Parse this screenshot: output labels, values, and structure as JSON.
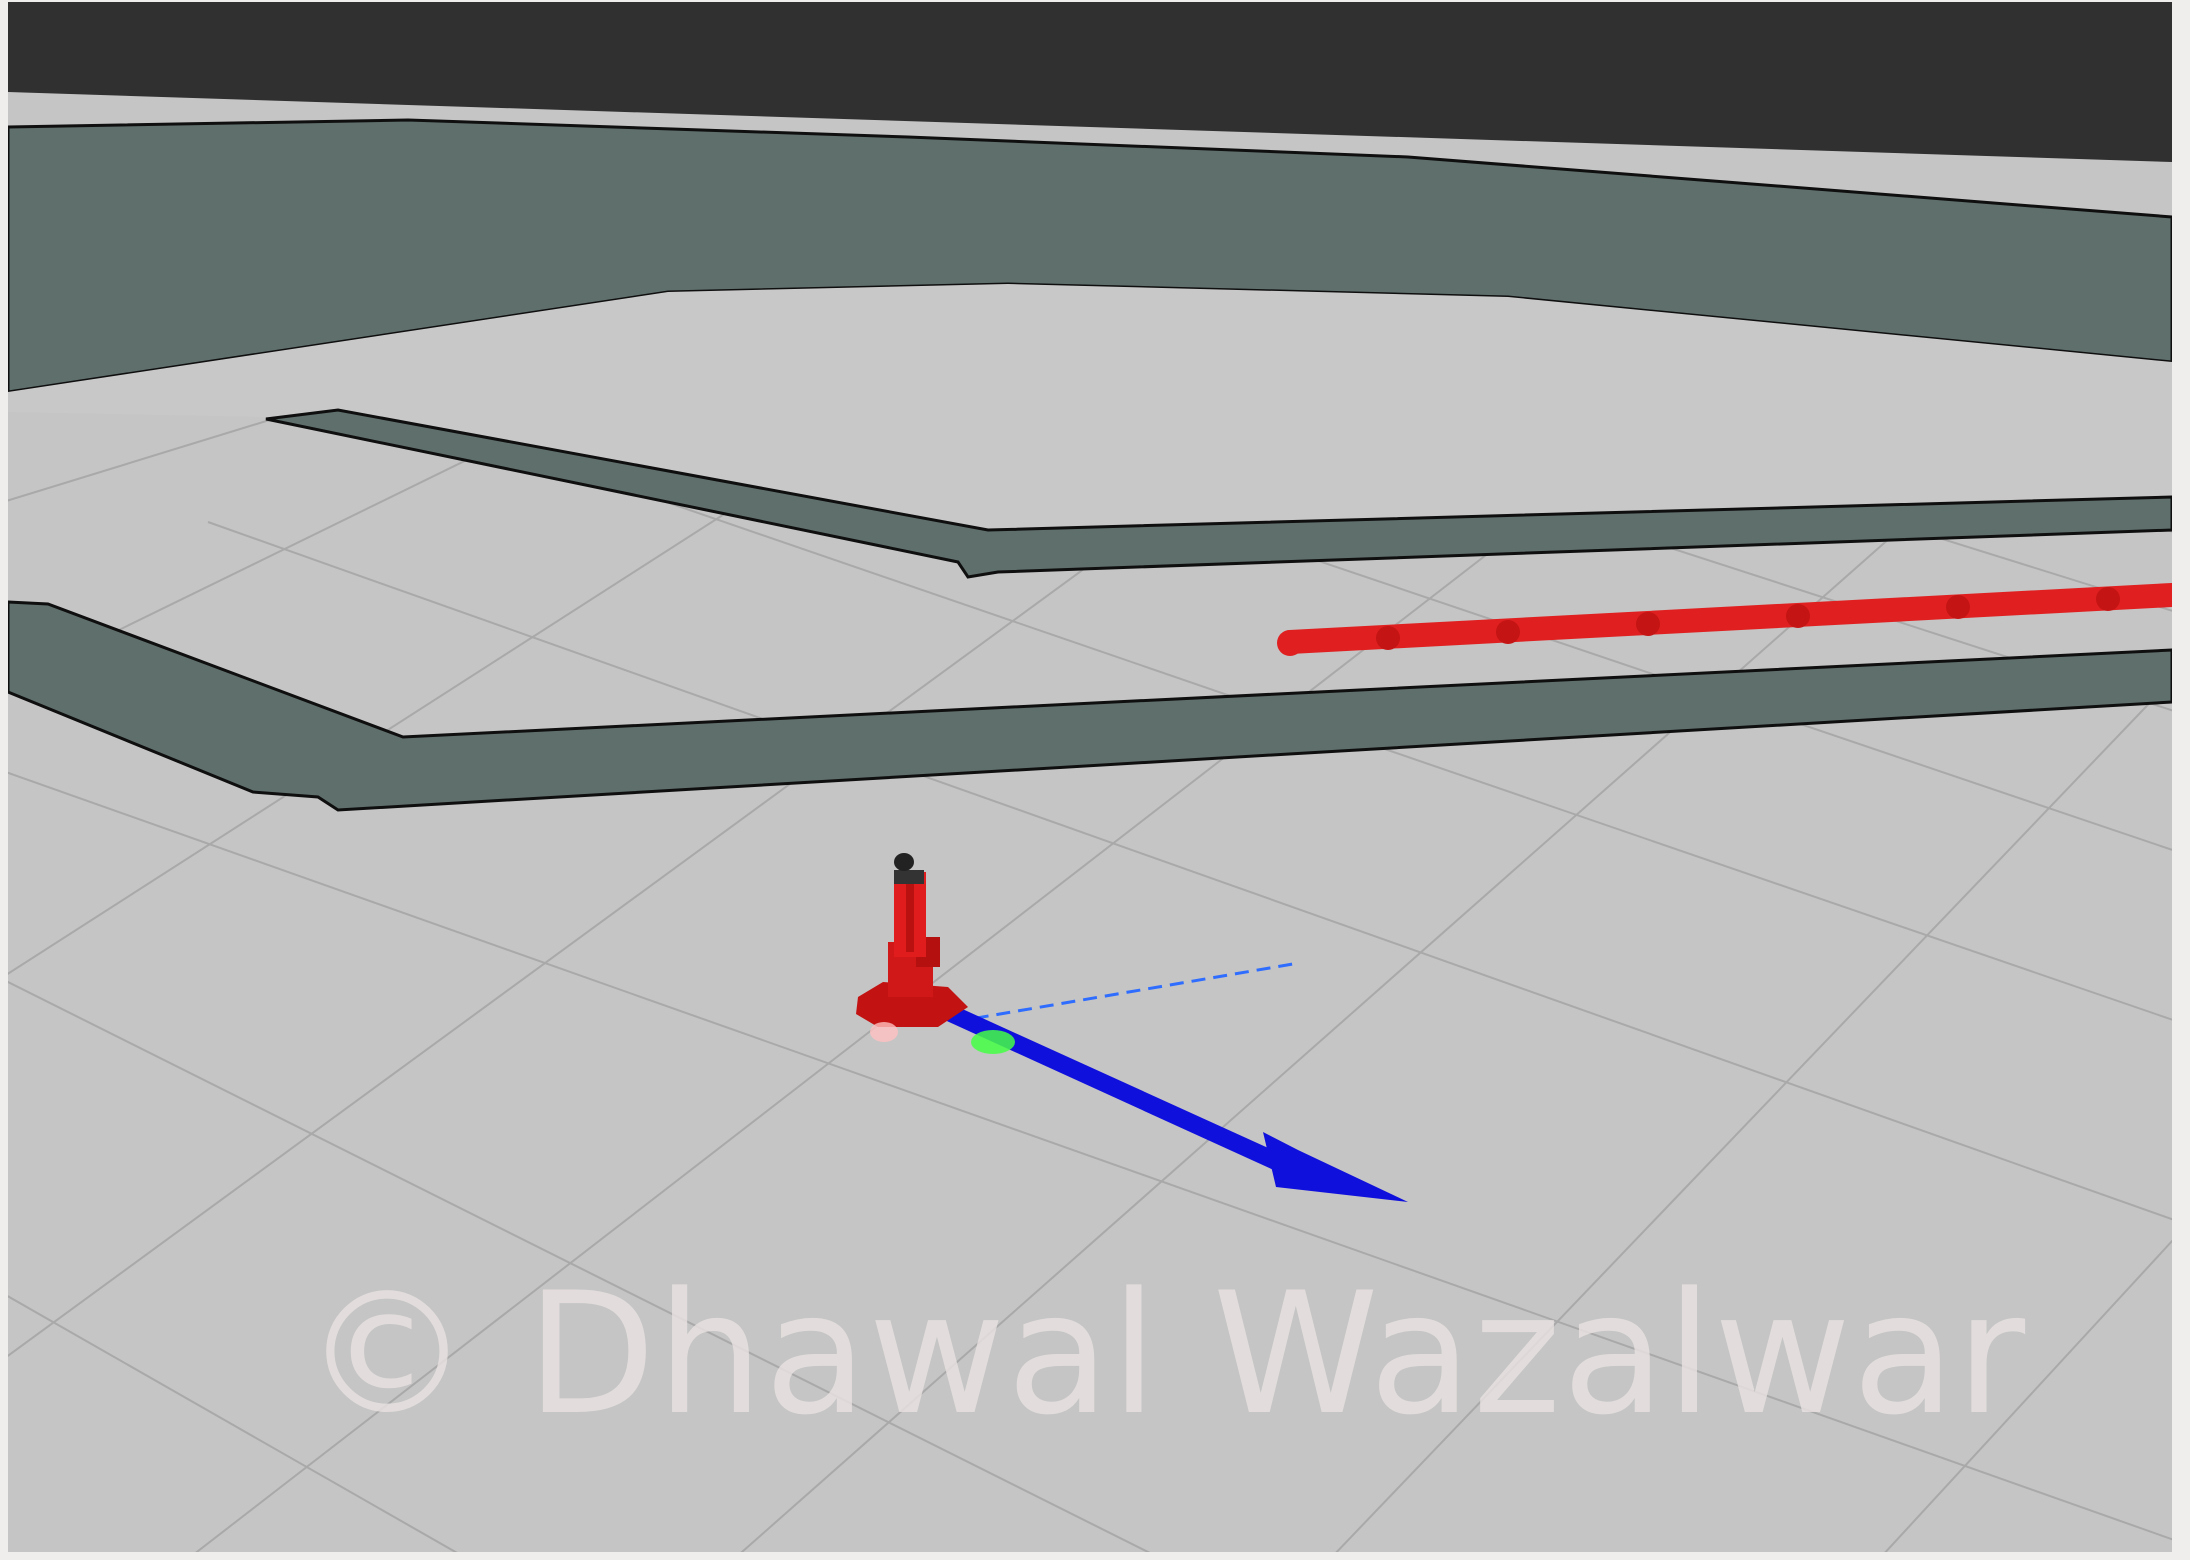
{
  "scene": {
    "background_color": "#303030",
    "floor_color": "#c5c5c5",
    "grid_color": "#a9a9a9",
    "map_wall_fill_color": "#5f6f6c",
    "map_wall_edge_color": "#0f0f0f",
    "path_color": "#e02020",
    "robot_color": "#d01818",
    "pose_arrow_color": "#1010dd",
    "dashed_line_color": "#2f6dff",
    "marker_color": "#44ff44"
  },
  "watermark": {
    "text": "© Dhawal Wazalwar",
    "color": "#e8e2e0"
  }
}
